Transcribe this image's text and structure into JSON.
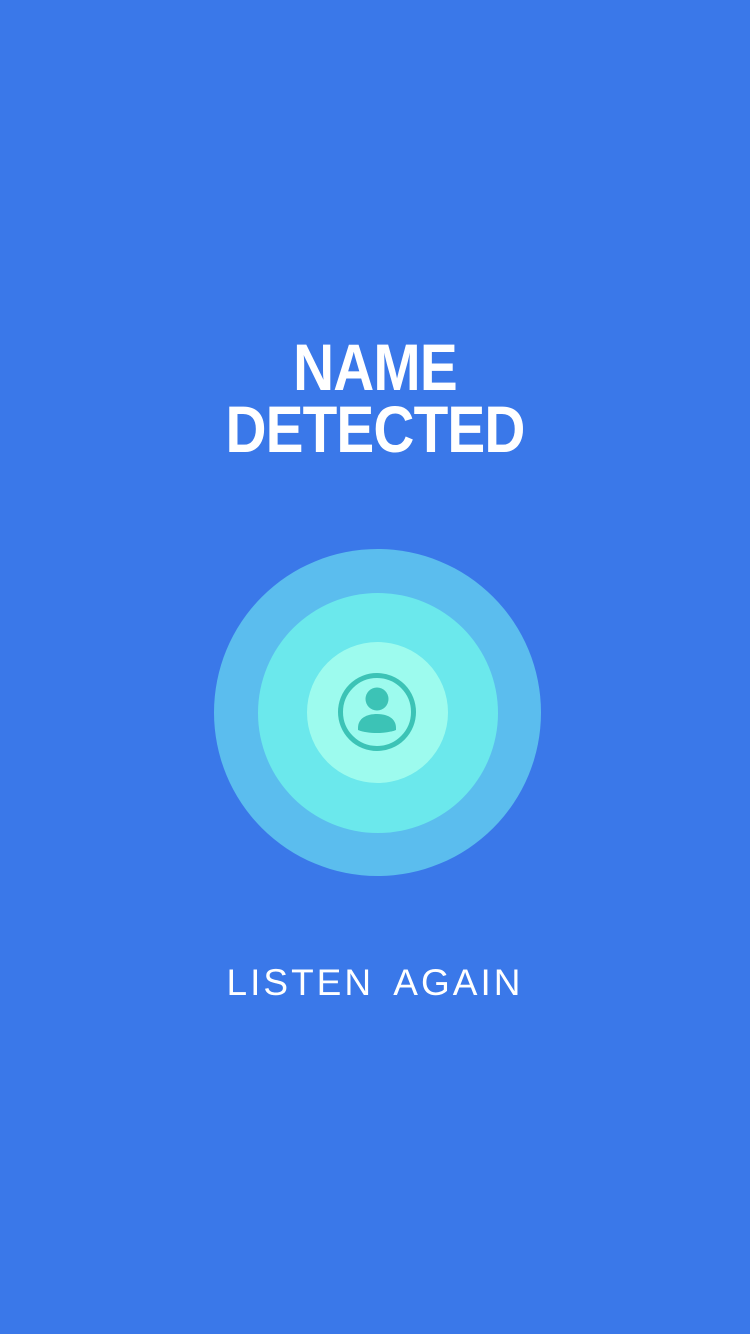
{
  "screen": {
    "title_line1": "NAME",
    "title_line2": "DETECTED",
    "action_label": "LISTEN AGAIN"
  },
  "avatar": {
    "icon": "person-circle-icon",
    "ring_colors": {
      "outer": "#5bbdee",
      "middle": "#6be8ec",
      "inner": "#9dfbee",
      "icon": "#3cc3b6"
    }
  },
  "colors": {
    "background": "#3a78e9",
    "text": "#ffffff"
  }
}
